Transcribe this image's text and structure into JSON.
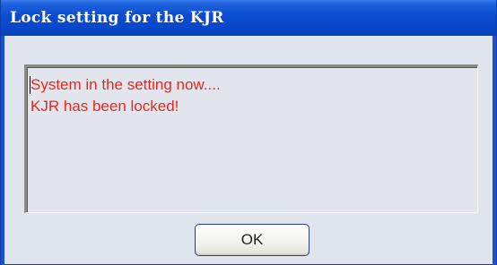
{
  "window": {
    "title": "Lock setting for the KJR"
  },
  "message": {
    "lines": [
      "System in the setting now....",
      "KJR has been locked!"
    ],
    "text_color": "#e8261f"
  },
  "buttons": {
    "ok_label": "OK"
  },
  "colors": {
    "titlebar": "#0b4cd0",
    "title_text": "#ffffff",
    "dialog_background": "#e0e4ec"
  }
}
